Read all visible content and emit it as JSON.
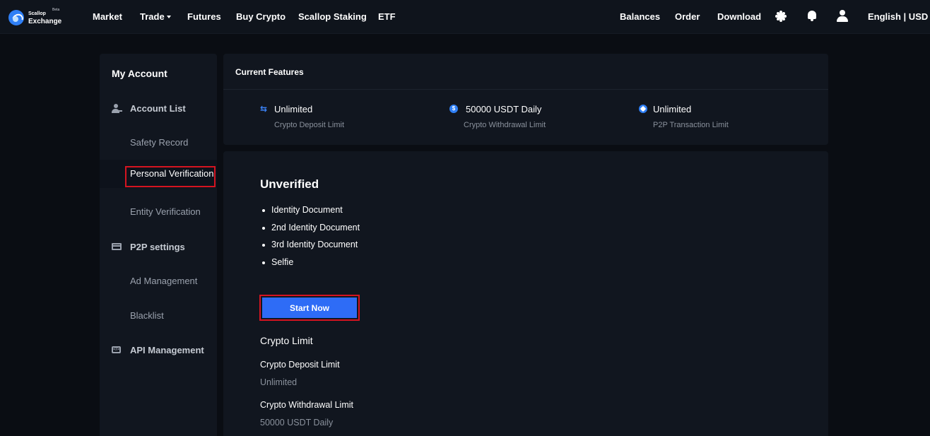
{
  "header": {
    "logo": {
      "line1": "Scallop",
      "line2": "Exchange",
      "badge": "Beta"
    },
    "nav": [
      {
        "label": "Market"
      },
      {
        "label": "Trade"
      },
      {
        "label": "Futures"
      },
      {
        "label": "Buy Crypto"
      },
      {
        "label": "Scallop Staking"
      },
      {
        "label": "ETF"
      }
    ],
    "right": {
      "balances": "Balances",
      "order": "Order",
      "download": "Download",
      "language": "English | USD"
    },
    "icons": [
      "sun-icon",
      "bell-icon",
      "user-icon"
    ]
  },
  "sidebar": {
    "title": "My Account",
    "groups": {
      "account": {
        "label": "Account List",
        "icon": "user-list-icon"
      },
      "p2p": {
        "label": "P2P settings",
        "icon": "card-icon"
      },
      "api": {
        "label": "API Management",
        "icon": "api-icon"
      }
    },
    "items": {
      "safety": "Safety Record",
      "personal": "Personal Verification",
      "entity": "Entity Verification",
      "ads": "Ad Management",
      "blacklist": "Blacklist"
    },
    "active": "Personal Verification"
  },
  "features": {
    "title": "Current Features",
    "items": [
      {
        "value": "Unlimited",
        "caption": "Crypto Deposit Limit",
        "icon": "swap-icon"
      },
      {
        "value": "50000 USDT Daily",
        "caption": "Crypto Withdrawal Limit",
        "icon": "dollar-coin-icon"
      },
      {
        "value": "Unlimited",
        "caption": "P2P Transaction Limit",
        "icon": "p2p-icon"
      }
    ]
  },
  "verification": {
    "status": "Unverified",
    "requirements": [
      "Identity Document",
      "2nd Identity Document",
      "3rd Identity Document",
      "Selfie"
    ],
    "button_label": "Start Now",
    "limits_title": "Crypto Limit",
    "limits": [
      {
        "label": "Crypto Deposit Limit",
        "value": "Unlimited"
      },
      {
        "label": "Crypto Withdrawal Limit",
        "value": "50000 USDT Daily"
      }
    ]
  },
  "colors": {
    "accent": "#2e6cf6",
    "highlight": "#d51420",
    "background": "#0a0d13",
    "card": "#11161f"
  }
}
